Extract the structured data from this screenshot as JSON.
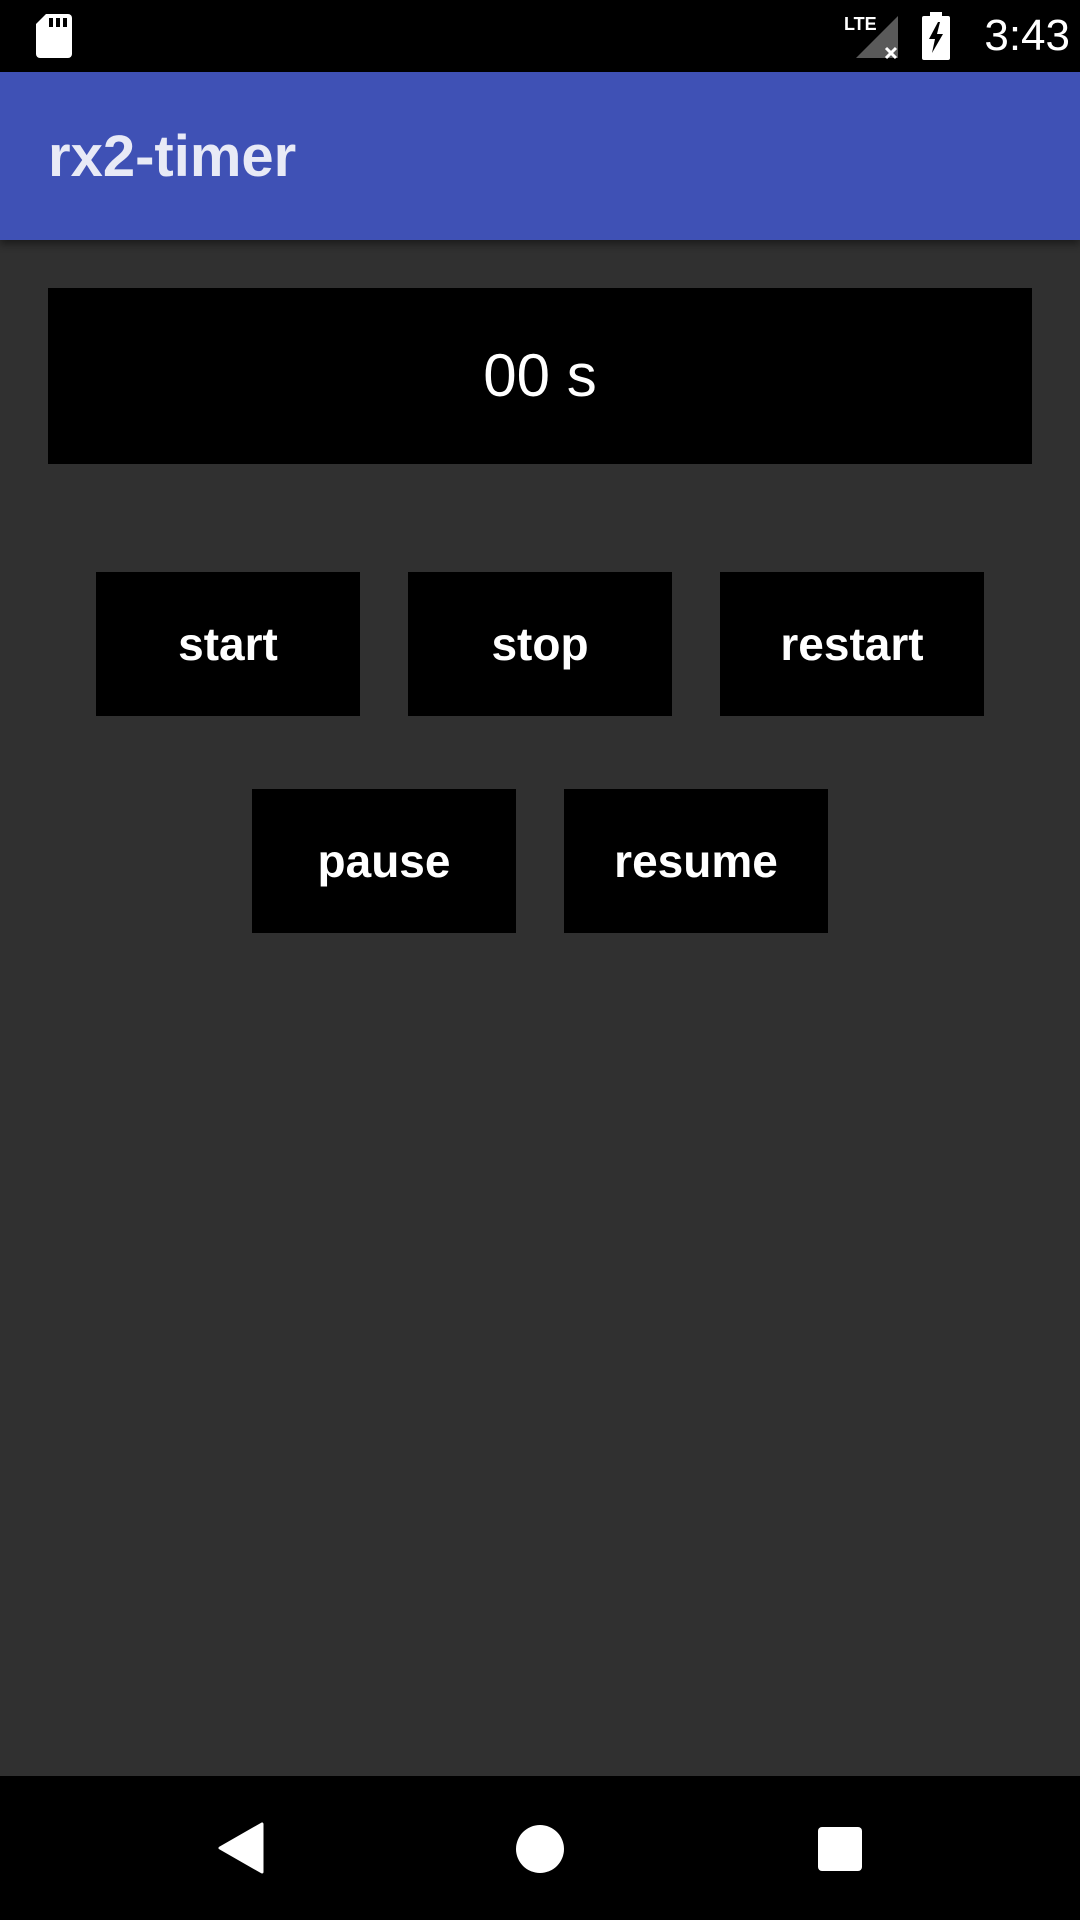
{
  "status_bar": {
    "time": "3:43",
    "network_label": "LTE",
    "icons": [
      "sd-card-icon",
      "lte-signal-icon",
      "battery-charging-icon"
    ]
  },
  "app_bar": {
    "title": "rx2-timer",
    "color": "#3f51b5"
  },
  "timer": {
    "display": "00 s"
  },
  "controls": {
    "start_label": "start",
    "stop_label": "stop",
    "restart_label": "restart",
    "pause_label": "pause",
    "resume_label": "resume"
  },
  "nav_bar": {
    "icons": [
      "back-icon",
      "home-icon",
      "recent-apps-icon"
    ]
  },
  "colors": {
    "background": "#303030",
    "surface": "#000000",
    "text": "#ffffff",
    "accent": "#3f51b5"
  }
}
